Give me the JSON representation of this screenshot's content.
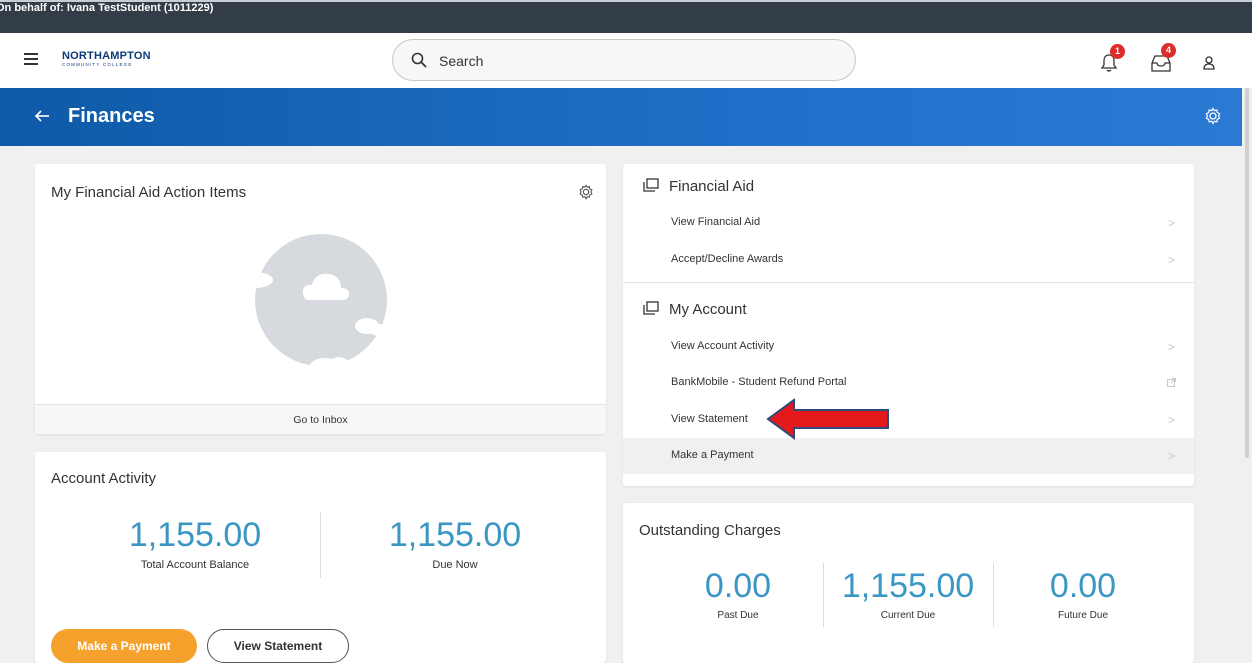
{
  "proxy": {
    "text": "On behalf of: Ivana TestStudent (1011229)"
  },
  "nav": {
    "logo_line1": "NORTHAMPTON",
    "logo_line2": "COMMUNITY COLLEGE",
    "search_placeholder": "Search",
    "notifications_count": "1",
    "inbox_count": "4"
  },
  "banner": {
    "title": "Finances"
  },
  "fa_action": {
    "title": "My Financial Aid Action Items",
    "footer_link": "Go to Inbox"
  },
  "account_activity": {
    "title": "Account Activity",
    "metrics": [
      {
        "value": "1,155.00",
        "label": "Total Account Balance"
      },
      {
        "value": "1,155.00",
        "label": "Due Now"
      }
    ],
    "make_payment_label": "Make a Payment",
    "view_statement_label": "View Statement"
  },
  "links": {
    "financial_aid": {
      "title": "Financial Aid",
      "items": [
        "View Financial Aid",
        "Accept/Decline Awards"
      ]
    },
    "my_account": {
      "title": "My Account",
      "items": [
        "View Account Activity",
        "BankMobile - Student Refund Portal",
        "View Statement",
        "Make a Payment"
      ]
    }
  },
  "outstanding": {
    "title": "Outstanding Charges",
    "metrics": [
      {
        "value": "0.00",
        "label": "Past Due"
      },
      {
        "value": "1,155.00",
        "label": "Current Due"
      },
      {
        "value": "0.00",
        "label": "Future Due"
      }
    ]
  },
  "colors": {
    "banner": "#1f70c8",
    "accent_blue": "#3a97c4",
    "orange_button": "#f5a12b",
    "badge_red": "#de2b2b",
    "annotation_arrow": "#e3191b"
  },
  "icons": {
    "menu": "hamburger-icon",
    "search": "search-icon",
    "notifications": "bell-icon",
    "inbox": "inbox-icon",
    "profile": "user-icon",
    "back": "back-arrow-icon",
    "settings": "gear-icon",
    "section": "window-stack-icon",
    "external": "external-link-icon",
    "chevron": "chevron-right-icon"
  }
}
